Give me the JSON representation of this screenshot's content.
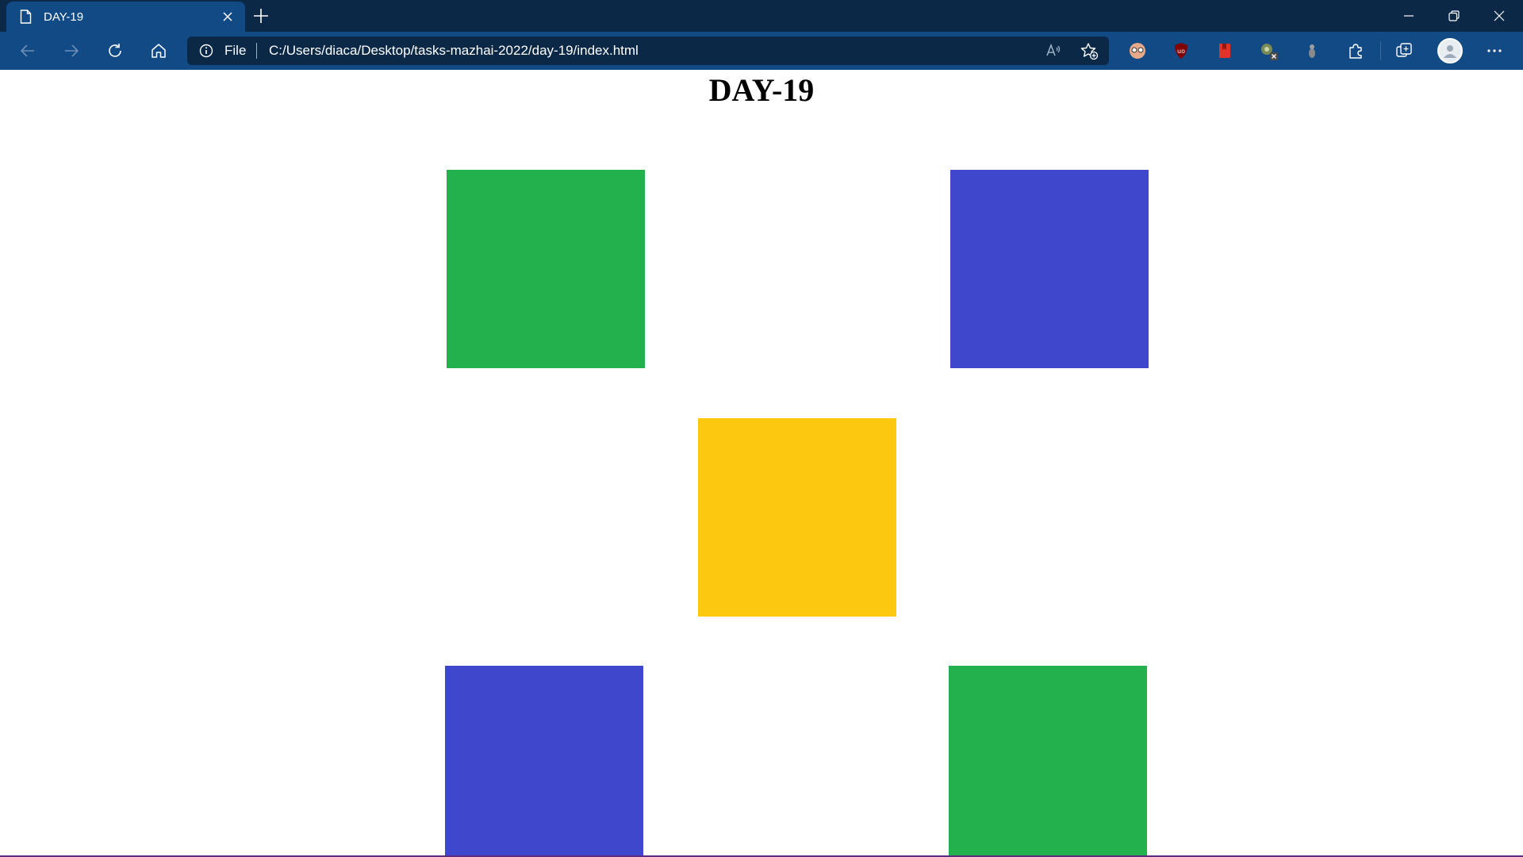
{
  "tab": {
    "title": "DAY-19"
  },
  "addressbar": {
    "scheme": "File",
    "url": "C:/Users/diaca/Desktop/tasks-mazhai-2022/day-19/index.html"
  },
  "page": {
    "heading": "DAY-19",
    "boxes": [
      {
        "name": "green-box-top-left",
        "color": "#22b14c"
      },
      {
        "name": "blue-box-top-right",
        "color": "#3f48cc"
      },
      {
        "name": "yellow-box-center",
        "color": "#fcc910"
      },
      {
        "name": "blue-box-bottom-left",
        "color": "#3f48cc"
      },
      {
        "name": "green-box-bottom-right",
        "color": "#22b14c"
      }
    ]
  },
  "colors": {
    "titlebar": "#0b2947",
    "toolbar": "#114a84"
  }
}
